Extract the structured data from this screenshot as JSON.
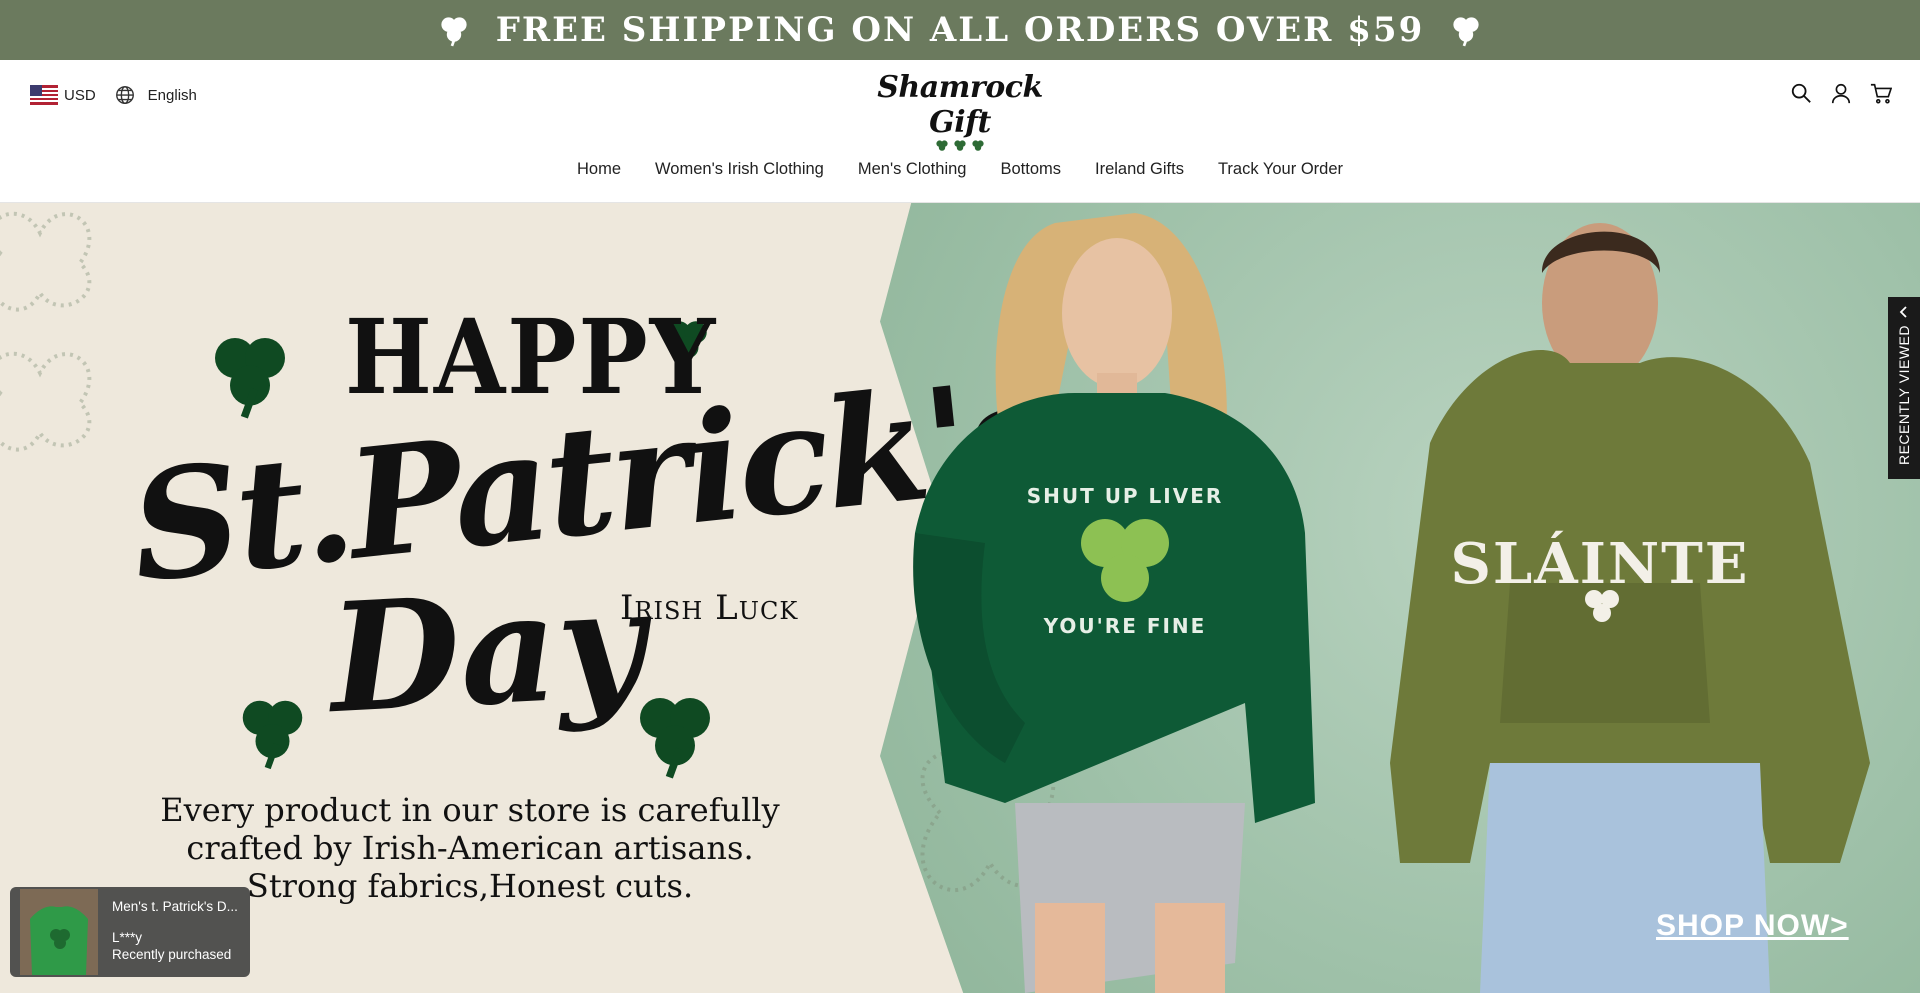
{
  "announcement": {
    "text": "FREE SHIPPING ON ALL ORDERS OVER $59",
    "icon": "shamrock-icon"
  },
  "header": {
    "currency": "USD",
    "language": "English",
    "logo_text": "Shamrock Gift",
    "icons": [
      "us-flag-icon",
      "globe-icon",
      "search-icon",
      "account-icon",
      "cart-icon"
    ]
  },
  "nav": {
    "items": [
      {
        "label": "Home"
      },
      {
        "label": "Women's Irish Clothing"
      },
      {
        "label": "Men's Clothing"
      },
      {
        "label": "Bottoms"
      },
      {
        "label": "Ireland Gifts"
      },
      {
        "label": "Track Your Order"
      }
    ]
  },
  "hero": {
    "headline_top": "HAPPY",
    "headline_main": "St.Patrick's",
    "headline_bottom": "Day",
    "subheadline": "Irish Luck",
    "tagline": [
      "Every product in our store is carefully",
      "crafted by Irish-American artisans.",
      "Strong fabrics,Honest cuts."
    ],
    "woman_hoodie_text_top": "SHUT UP LIVER",
    "woman_hoodie_text_bottom": "YOU'RE FINE",
    "man_hoodie_text": "SLÁINTE",
    "cta": "SHOP NOW>"
  },
  "recently_viewed": {
    "label": "RECENTLY VIEWED"
  },
  "purchase_popup": {
    "product": "Men's t. Patrick's D...",
    "buyer": "L***y",
    "status": "Recently purchased"
  },
  "colors": {
    "announcement_bg": "#6b7a5e",
    "hero_left_bg": "#eee8dc",
    "hero_right_bg": "#a6c5ae",
    "shamrock_green": "#0f4a22",
    "hoodie_green": "#0e5a36",
    "hoodie_olive": "#6e7a3a"
  }
}
